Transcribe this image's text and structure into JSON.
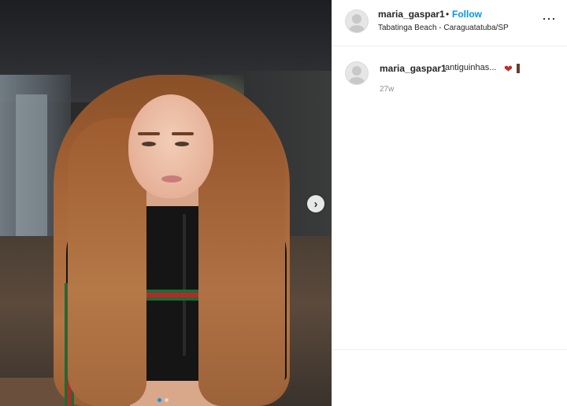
{
  "post": {
    "header": {
      "username": "maria_gaspar1",
      "separator": "•",
      "follow_label": "Follow",
      "location": "Tabatinga Beach - Caraguatatuba/SP",
      "more_icon": "⋯"
    },
    "caption": {
      "username": "maria_gaspar1",
      "text": "antiguinhas...",
      "emoji_heart": "❤",
      "time": "27w"
    },
    "carousel": {
      "next_icon": "›",
      "current_index": 1,
      "total": 2
    },
    "colors": {
      "follow_blue": "#0095f6",
      "text": "#262626",
      "muted": "#8e8e8e"
    }
  }
}
